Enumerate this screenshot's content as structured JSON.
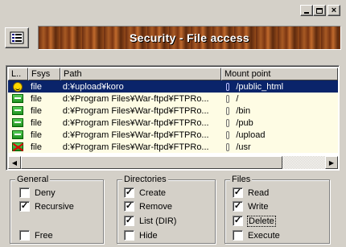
{
  "window": {
    "controls": {
      "minimize": "",
      "maximize": "",
      "close": "×"
    }
  },
  "header": {
    "title": "Security - File access"
  },
  "list": {
    "columns": [
      "L..",
      "Fsys",
      "Path",
      "Mount point"
    ],
    "rows": [
      {
        "icon": "smiley-icon",
        "fsys": "file",
        "path": "d:¥upload¥koro",
        "mount": "/public_html",
        "selected": true
      },
      {
        "icon": "green-folder-icon",
        "fsys": "file",
        "path": "d:¥Program Files¥War-ftpd¥FTPRo...",
        "mount": "/",
        "selected": false
      },
      {
        "icon": "green-folder-icon",
        "fsys": "file",
        "path": "d:¥Program Files¥War-ftpd¥FTPRo...",
        "mount": "/bin",
        "selected": false
      },
      {
        "icon": "green-folder-icon",
        "fsys": "file",
        "path": "d:¥Program Files¥War-ftpd¥FTPRo...",
        "mount": "/pub",
        "selected": false
      },
      {
        "icon": "green-folder-icon",
        "fsys": "file",
        "path": "d:¥Program Files¥War-ftpd¥FTPRo...",
        "mount": "/upload",
        "selected": false
      },
      {
        "icon": "denied-folder-icon",
        "fsys": "file",
        "path": "d:¥Program Files¥War-ftpd¥FTPRo...",
        "mount": "/usr",
        "selected": false
      }
    ]
  },
  "groups": {
    "general": {
      "label": "General",
      "items": [
        {
          "label": "Deny",
          "checked": false
        },
        {
          "label": "Recursive",
          "checked": true
        },
        {
          "label": "Free",
          "checked": false
        }
      ]
    },
    "directories": {
      "label": "Directories",
      "items": [
        {
          "label": "Create",
          "checked": true
        },
        {
          "label": "Remove",
          "checked": true
        },
        {
          "label": "List (DIR)",
          "checked": true
        },
        {
          "label": "Hide",
          "checked": false
        }
      ]
    },
    "files": {
      "label": "Files",
      "items": [
        {
          "label": "Read",
          "checked": true
        },
        {
          "label": "Write",
          "checked": true
        },
        {
          "label": "Delete",
          "checked": true
        },
        {
          "label": "Execute",
          "checked": false
        }
      ]
    }
  },
  "colors": {
    "selection": "#0a246a",
    "row_alt": "#fefce4",
    "face": "#d4d0c8"
  }
}
